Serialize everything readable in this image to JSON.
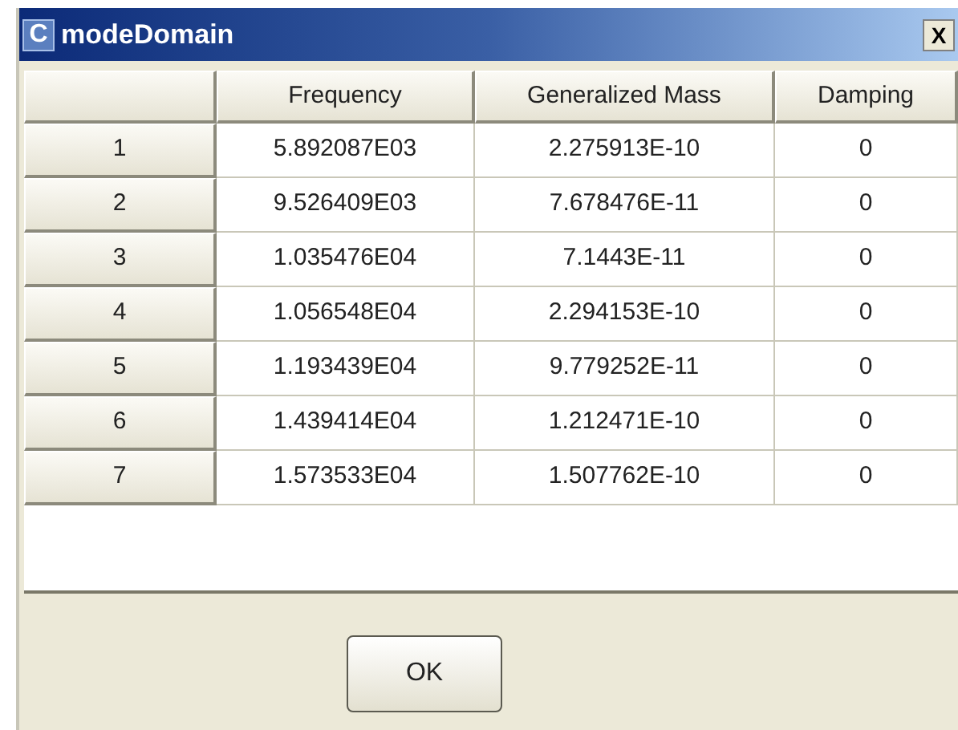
{
  "window": {
    "icon_letter": "C",
    "title": "modeDomain",
    "close": "X"
  },
  "table": {
    "columns": [
      "Frequency",
      "Generalized Mass",
      "Damping"
    ],
    "rows": [
      {
        "header": "1",
        "cells": [
          "5.892087E03",
          "2.275913E-10",
          "0"
        ]
      },
      {
        "header": "2",
        "cells": [
          "9.526409E03",
          "7.678476E-11",
          "0"
        ]
      },
      {
        "header": "3",
        "cells": [
          "1.035476E04",
          "7.1443E-11",
          "0"
        ]
      },
      {
        "header": "4",
        "cells": [
          "1.056548E04",
          "2.294153E-10",
          "0"
        ]
      },
      {
        "header": "5",
        "cells": [
          "1.193439E04",
          "9.779252E-11",
          "0"
        ]
      },
      {
        "header": "6",
        "cells": [
          "1.439414E04",
          "1.212471E-10",
          "0"
        ]
      },
      {
        "header": "7",
        "cells": [
          "1.573533E04",
          "1.507762E-10",
          "0"
        ]
      }
    ]
  },
  "buttons": [
    "OK"
  ]
}
